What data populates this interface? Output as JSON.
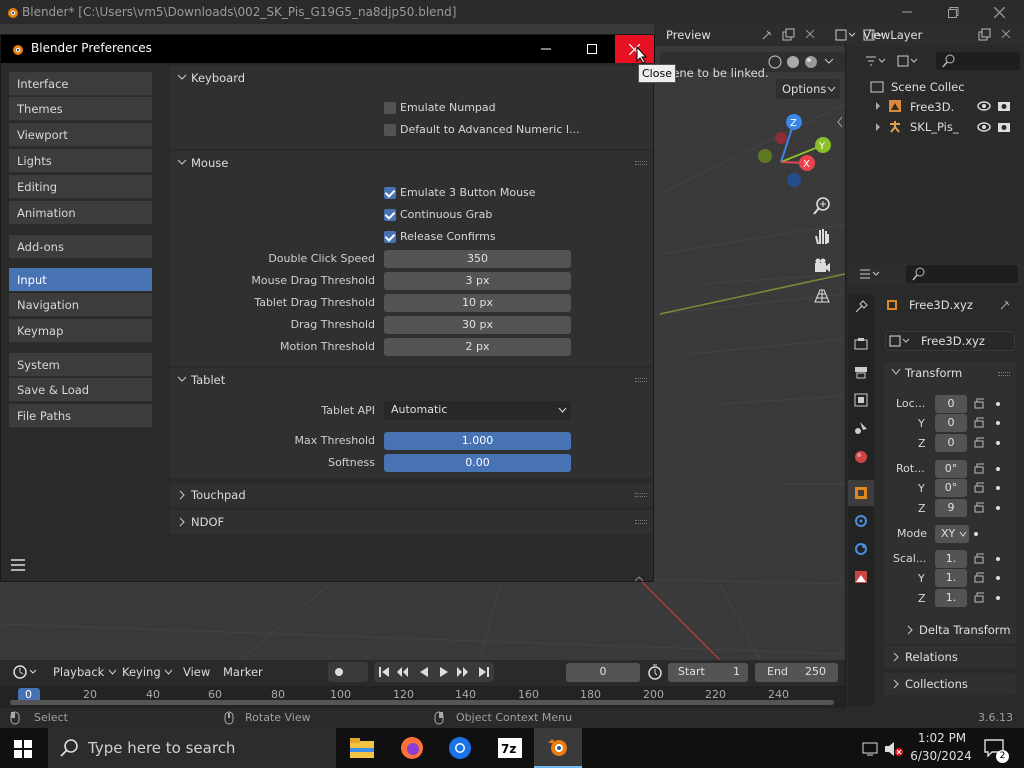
{
  "app_title": "Blender* [C:\\Users\\vm5\\Downloads\\002_SK_Pis_G19G5_na8djp50.blend]",
  "header": {
    "preview_label": "Preview",
    "view_layer": "ViewLayer",
    "options_label": "Options",
    "viewport_message": "scene to be linked.",
    "close_tooltip": "Close"
  },
  "outliner": {
    "scene_collection": "Scene Collec",
    "items": [
      {
        "name": "Free3D."
      },
      {
        "name": "SKL_Pis_"
      }
    ]
  },
  "properties": {
    "object_name": "Free3D.xyz",
    "data_name": "Free3D.xyz",
    "transform_label": "Transform",
    "location_label": "Loc...",
    "rotation_label": "Rot...",
    "scale_label": "Scal...",
    "axis_y": "Y",
    "axis_z": "Z",
    "location": [
      "0",
      "0",
      "0"
    ],
    "rotation": [
      "0°",
      "0°",
      "9"
    ],
    "mode_label": "Mode",
    "mode_value": "XY",
    "scale": [
      "1.",
      "1.",
      "1."
    ],
    "delta_transform": "Delta Transform",
    "relations": "Relations",
    "collections": "Collections"
  },
  "prefs": {
    "title": "Blender Preferences",
    "nav_groups": [
      [
        "Interface",
        "Themes",
        "Viewport",
        "Lights",
        "Editing",
        "Animation"
      ],
      [
        "Add-ons"
      ],
      [
        "Input",
        "Navigation",
        "Keymap"
      ],
      [
        "System",
        "Save & Load",
        "File Paths"
      ]
    ],
    "active_item": "Input",
    "keyboard": {
      "header": "Keyboard",
      "emulate_numpad": "Emulate Numpad",
      "default_advanced_numeric": "Default to Advanced Numeric I..."
    },
    "mouse": {
      "header": "Mouse",
      "emulate_3_button": "Emulate 3 Button Mouse",
      "continuous_grab": "Continuous Grab",
      "release_confirms": "Release Confirms",
      "fields": [
        {
          "label": "Double Click Speed",
          "value": "350"
        },
        {
          "label": "Mouse Drag Threshold",
          "value": "3 px"
        },
        {
          "label": "Tablet Drag Threshold",
          "value": "10 px"
        },
        {
          "label": "Drag Threshold",
          "value": "30 px"
        },
        {
          "label": "Motion Threshold",
          "value": "2 px"
        }
      ]
    },
    "tablet": {
      "header": "Tablet",
      "api_label": "Tablet API",
      "api_value": "Automatic",
      "max_threshold_label": "Max Threshold",
      "max_threshold_value": "1.000",
      "softness_label": "Softness",
      "softness_value": "0.00"
    },
    "touchpad_header": "Touchpad",
    "ndof_header": "NDOF"
  },
  "timeline": {
    "playback": "Playback",
    "keying": "Keying",
    "view": "View",
    "marker": "Marker",
    "current_frame": "0",
    "start_label": "Start",
    "start_value": "1",
    "end_label": "End",
    "end_value": "250",
    "ruler": [
      "0",
      "20",
      "40",
      "60",
      "80",
      "100",
      "120",
      "140",
      "160",
      "180",
      "200",
      "220",
      "240"
    ]
  },
  "statusbar": {
    "select": "Select",
    "rotate_view": "Rotate View",
    "object_context_menu": "Object Context Menu",
    "version": "3.6.13"
  },
  "taskbar": {
    "search_placeholder": "Type here to search",
    "time": "1:02 PM",
    "date": "6/30/2024"
  },
  "colors": {
    "accent": "#4772b3",
    "close_red": "#e81123",
    "axis_x": "#e8434f",
    "axis_y": "#8bbf2a",
    "axis_z": "#3b86e8"
  }
}
